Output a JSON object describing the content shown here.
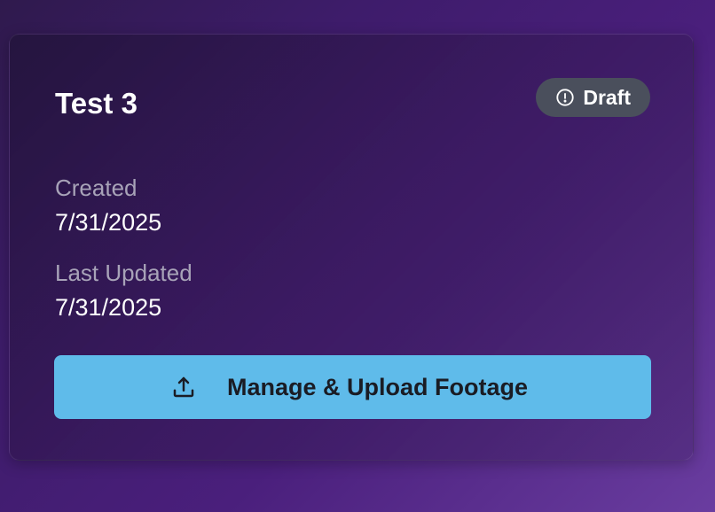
{
  "card": {
    "title": "Test 3",
    "status_badge": {
      "label": "Draft",
      "icon": "alert-circle-icon",
      "color": "#4a4f5c"
    },
    "created": {
      "label": "Created",
      "value": "7/31/2025"
    },
    "last_updated": {
      "label": "Last Updated",
      "value": "7/31/2025"
    },
    "action_button": {
      "label": "Manage & Upload Footage",
      "icon": "upload-icon",
      "color": "#5fbbea"
    }
  }
}
